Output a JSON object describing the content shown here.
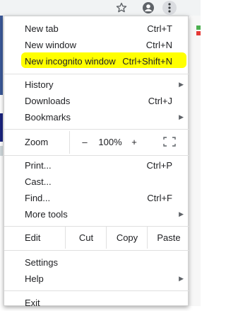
{
  "menu": {
    "new_tab": {
      "label": "New tab",
      "shortcut": "Ctrl+T"
    },
    "new_window": {
      "label": "New window",
      "shortcut": "Ctrl+N"
    },
    "new_incognito": {
      "label": "New incognito window",
      "shortcut": "Ctrl+Shift+N"
    },
    "history": {
      "label": "History"
    },
    "downloads": {
      "label": "Downloads",
      "shortcut": "Ctrl+J"
    },
    "bookmarks": {
      "label": "Bookmarks"
    },
    "zoom": {
      "label": "Zoom",
      "minus": "–",
      "value": "100%",
      "plus": "+"
    },
    "print": {
      "label": "Print...",
      "shortcut": "Ctrl+P"
    },
    "cast": {
      "label": "Cast..."
    },
    "find": {
      "label": "Find...",
      "shortcut": "Ctrl+F"
    },
    "more_tools": {
      "label": "More tools"
    },
    "edit": {
      "label": "Edit",
      "cut": "Cut",
      "copy": "Copy",
      "paste": "Paste"
    },
    "settings": {
      "label": "Settings"
    },
    "help": {
      "label": "Help"
    },
    "exit": {
      "label": "Exit"
    }
  },
  "submenu_arrow": "▶",
  "colors": {
    "highlight": "#ffff00",
    "toolbar_bg": "#f1f3f4"
  }
}
